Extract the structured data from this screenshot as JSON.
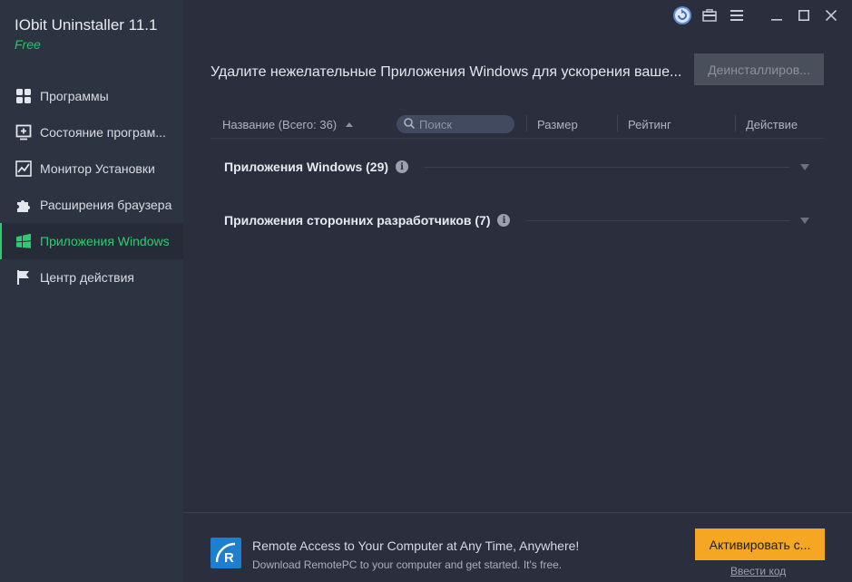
{
  "app": {
    "title": "IObit Uninstaller 11.1",
    "edition": "Free"
  },
  "sidebar": {
    "items": [
      {
        "label": "Программы",
        "icon": "grid-icon"
      },
      {
        "label": "Состояние програм...",
        "icon": "monitor-plus-icon"
      },
      {
        "label": "Монитор Установки",
        "icon": "chart-line-icon"
      },
      {
        "label": "Расширения браузера",
        "icon": "puzzle-icon"
      },
      {
        "label": "Приложения Windows",
        "icon": "windows-logo-icon",
        "active": true
      },
      {
        "label": "Центр действия",
        "icon": "flag-icon"
      }
    ]
  },
  "window_controls": [
    "refresh-icon",
    "toolbox-icon",
    "menu-icon",
    "minimize-icon",
    "maximize-icon",
    "close-icon"
  ],
  "main": {
    "header_text": "Удалите нежелательные Приложения Windows для ускорения ваше...",
    "uninstall_label": "Деинсталлиров...",
    "columns": {
      "name": "Название (Всего: 36)",
      "search_placeholder": "Поиск",
      "size": "Размер",
      "rating": "Рейтинг",
      "action": "Действие"
    },
    "groups": [
      {
        "label": "Приложения Windows (29)"
      },
      {
        "label": "Приложения сторонних разработчиков (7)"
      }
    ]
  },
  "footer": {
    "promo_title": "Remote Access to Your Computer at Any Time, Anywhere!",
    "promo_sub": "Download RemotePC to your computer and get started. It's free.",
    "activate_label": "Активировать с...",
    "enter_code": "Ввести код"
  },
  "colors": {
    "accent_green": "#2ecc71",
    "activate_orange": "#f5a623",
    "sidebar_bg": "#2c3441",
    "main_bg": "#2a2e3d"
  }
}
